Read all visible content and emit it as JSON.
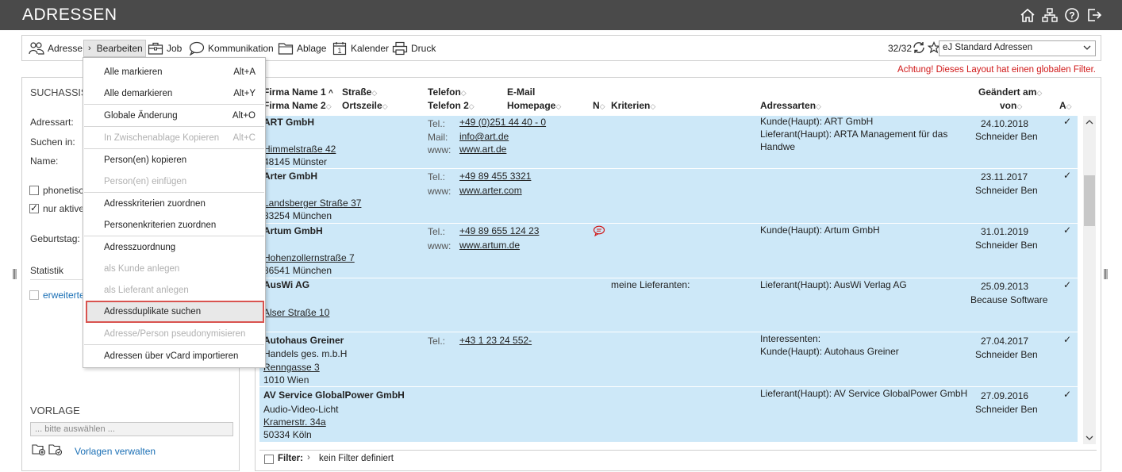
{
  "window": {
    "title": "ADRESSEN"
  },
  "toolbar": {
    "items": [
      {
        "label": "Adresse"
      },
      {
        "label": "Bearbeiten"
      },
      {
        "label": "Job"
      },
      {
        "label": "Kommunikation"
      },
      {
        "label": "Ablage"
      },
      {
        "label": "Kalender"
      },
      {
        "label": "Druck"
      }
    ],
    "record_count": "32/32",
    "layout_value": "eJ Standard Adressen"
  },
  "warning": "Achtung! Dieses Layout hat einen globalen Filter.",
  "search_panel": {
    "title": "SUCHASSIS",
    "adressart": "Adressart:",
    "suchen_in": "Suchen in:",
    "name": "Name:",
    "phonetisch": "phonetisch",
    "nur_aktive": "nur aktive",
    "geburtstag": "Geburtstag:",
    "statistik": "Statistik",
    "erweiterte": "erweiterte",
    "vorlage_title": "VORLAGE",
    "vorlage_placeholder": "... bitte auswählen ...",
    "vorlagen_verwalten": "Vorlagen verwalten"
  },
  "menu": {
    "items": [
      {
        "label": "Alle markieren",
        "shortcut": "Alt+A",
        "enabled": true
      },
      {
        "label": "Alle demarkieren",
        "shortcut": "Alt+Y",
        "enabled": true
      },
      {
        "label": "Globale Änderung",
        "shortcut": "Alt+O",
        "enabled": true
      },
      {
        "label": "In Zwischenablage Kopieren",
        "shortcut": "Alt+C",
        "enabled": false
      },
      {
        "label": "Person(en) kopieren",
        "shortcut": "",
        "enabled": true
      },
      {
        "label": "Person(en) einfügen",
        "shortcut": "",
        "enabled": false
      },
      {
        "label": "Adresskriterien zuordnen",
        "shortcut": "",
        "enabled": true
      },
      {
        "label": "Personenkriterien zuordnen",
        "shortcut": "",
        "enabled": true
      },
      {
        "label": "Adresszuordnung",
        "shortcut": "",
        "enabled": true
      },
      {
        "label": "als Kunde anlegen",
        "shortcut": "",
        "enabled": false
      },
      {
        "label": "als Lieferant anlegen",
        "shortcut": "",
        "enabled": false
      },
      {
        "label": "Adressduplikate suchen",
        "shortcut": "",
        "enabled": true,
        "highlighted": true
      },
      {
        "label": "Adresse/Person pseudonymisieren",
        "shortcut": "",
        "enabled": false
      },
      {
        "label": "Adressen über vCard importieren",
        "shortcut": "",
        "enabled": true
      }
    ]
  },
  "grid": {
    "headers": {
      "firma1": "Firma Name 1",
      "firma2": "Firma Name 2",
      "strasse": "Straße",
      "ortszeile": "Ortszeile",
      "telefon": "Telefon",
      "telefon2": "Telefon 2",
      "email": "E-Mail",
      "homepage": "Homepage",
      "n": "N",
      "kriterien": "Kriterien",
      "adressarten": "Adressarten",
      "geaendert": "Geändert am",
      "von": "von",
      "a": "A"
    },
    "rows": [
      {
        "name1": "ART GmbH",
        "name2": "",
        "street": "Himmelstraße 42",
        "city": "48145 Münster",
        "comm": [
          {
            "label": "Tel.:",
            "value": "+49 (0)251 44 40 - 0"
          },
          {
            "label": "Mail:",
            "value": "info@art.de"
          },
          {
            "label": "www:",
            "value": "www.art.de"
          }
        ],
        "note": false,
        "kriterien": "",
        "adressarten": [
          "Kunde(Haupt): ART GmbH",
          "Lieferant(Haupt): ARTA Management für das",
          "Handwe"
        ],
        "date": "24.10.2018",
        "user": "Schneider Ben",
        "active": "✓"
      },
      {
        "name1": "Arter GmbH",
        "name2": "",
        "street": "Landsberger Straße 37",
        "city": "83254 München",
        "comm": [
          {
            "label": "Tel.:",
            "value": "+49 89 455 3321"
          },
          {
            "label": "www:",
            "value": "www.arter.com"
          }
        ],
        "note": false,
        "kriterien": "",
        "adressarten": [],
        "date": "23.11.2017",
        "user": "Schneider Ben",
        "active": "✓"
      },
      {
        "name1": "Artum GmbH",
        "name2": "",
        "street": "Hohenzollernstraße 7",
        "city": "86541 München",
        "comm": [
          {
            "label": "Tel.:",
            "value": "+49 89 655 124 23"
          },
          {
            "label": "www:",
            "value": "www.artum.de"
          }
        ],
        "note": true,
        "kriterien": "",
        "adressarten": [
          "Kunde(Haupt): Artum GmbH"
        ],
        "date": "31.01.2019",
        "user": "Schneider Ben",
        "active": "✓"
      },
      {
        "name1": "AusWi AG",
        "name2": "",
        "street": "Alser Straße 10",
        "city": "",
        "comm": [],
        "note": false,
        "kriterien": "meine Lieferanten:",
        "adressarten": [
          "Lieferant(Haupt): AusWi Verlag AG"
        ],
        "date": "25.09.2013",
        "user": "Because Software",
        "active": "✓"
      },
      {
        "name1": "Autohaus Greiner",
        "name2": "Handels ges. m.b.H",
        "street": "Renngasse 3",
        "city": "1010 Wien",
        "comm": [
          {
            "label": "Tel.:",
            "value": "+43 1 23 24 552-"
          }
        ],
        "note": false,
        "kriterien": "",
        "adressarten": [
          "Interessenten:",
          "Kunde(Haupt): Autohaus Greiner"
        ],
        "date": "27.04.2017",
        "user": "Schneider Ben",
        "active": "✓"
      },
      {
        "name1": "AV Service GlobalPower GmbH",
        "name2": "Audio-Video-Licht",
        "street": "Kramerstr. 34a",
        "city": "50334 Köln",
        "comm": [],
        "note": false,
        "kriterien": "",
        "adressarten": [
          "Lieferant(Haupt): AV Service GlobalPower GmbH"
        ],
        "date": "27.09.2016",
        "user": "Schneider Ben",
        "active": "✓"
      }
    ],
    "filter_label": "Filter:",
    "filter_value": "kein Filter definiert"
  }
}
